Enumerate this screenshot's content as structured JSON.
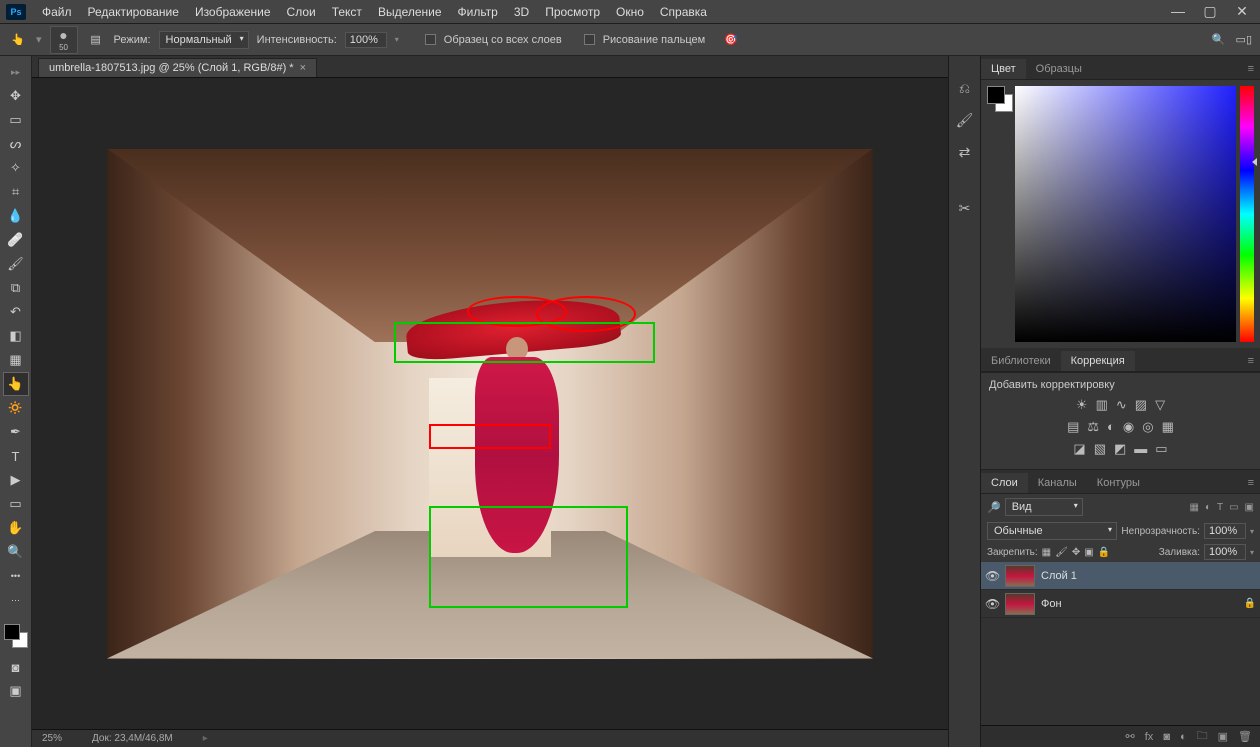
{
  "menubar": {
    "items": [
      "Файл",
      "Редактирование",
      "Изображение",
      "Слои",
      "Текст",
      "Выделение",
      "Фильтр",
      "3D",
      "Просмотр",
      "Окно",
      "Справка"
    ]
  },
  "options": {
    "brush_size": "50",
    "mode_label": "Режим:",
    "mode_value": "Нормальный",
    "intensity_label": "Интенсивность:",
    "intensity_value": "100%",
    "sample_all_label": "Образец со всех слоев",
    "finger_paint_label": "Рисование пальцем"
  },
  "document": {
    "tab_title": "umbrella-1807513.jpg @ 25% (Слой 1, RGB/8#) *",
    "zoom": "25%",
    "doc_info": "Док: 23,4M/46,8M"
  },
  "panels": {
    "color_tab": "Цвет",
    "swatches_tab": "Образцы",
    "libraries_tab": "Библиотеки",
    "adjustments_tab": "Коррекция",
    "adjustments_title": "Добавить корректировку",
    "layers_tab": "Слои",
    "channels_tab": "Каналы",
    "paths_tab": "Контуры"
  },
  "layers": {
    "search_label": "Вид",
    "blend_mode": "Обычные",
    "opacity_label": "Непрозрачность:",
    "opacity_value": "100%",
    "lock_label": "Закрепить:",
    "fill_label": "Заливка:",
    "fill_value": "100%",
    "items": [
      {
        "name": "Слой 1",
        "locked": false
      },
      {
        "name": "Фон",
        "locked": true
      }
    ]
  }
}
